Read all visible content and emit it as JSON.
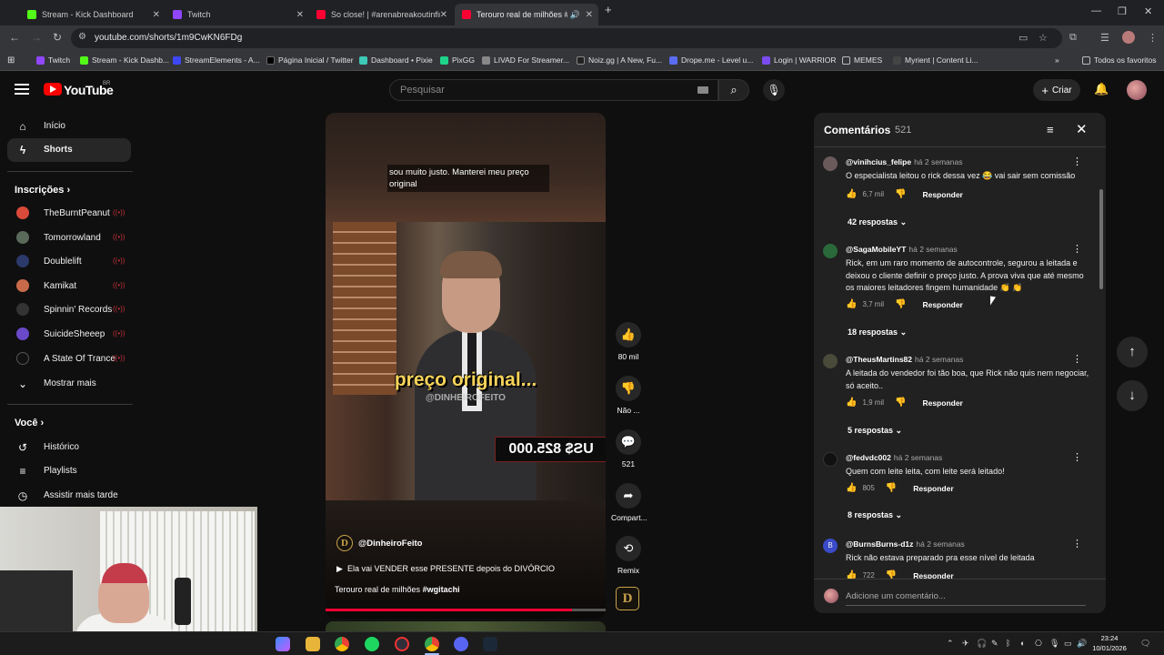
{
  "browser": {
    "tabs": [
      {
        "title": "Stream - Kick Dashboard",
        "color": "#53fc18",
        "active": false
      },
      {
        "title": "Twitch",
        "color": "#9146ff",
        "active": false
      },
      {
        "title": "So close! | #arenabreakoutinfin",
        "color": "#ff0033",
        "active": false
      },
      {
        "title": "Terouro real de milhões #w",
        "color": "#ff0033",
        "active": true
      }
    ],
    "url": "youtube.com/shorts/1m9CwKN6FDg",
    "bookmarks": [
      {
        "label": "Twitch",
        "color": "#9146ff"
      },
      {
        "label": "Stream - Kick Dashb...",
        "color": "#53fc18"
      },
      {
        "label": "StreamElements - A...",
        "color": "#3d47f2"
      },
      {
        "label": "Página Inicial / Twitter",
        "color": "#000000"
      },
      {
        "label": "Dashboard • Pixie",
        "color": "#3ec9b8"
      },
      {
        "label": "PixGG",
        "color": "#1ed48a"
      },
      {
        "label": "LIVAD For Streamer...",
        "color": "#888888"
      },
      {
        "label": "Noiz.gg | A New, Fu...",
        "color": "#222222"
      },
      {
        "label": "Drope.me - Level u...",
        "color": "#5a6cf0"
      },
      {
        "label": "Login | WARRIOR",
        "color": "#7a4cf0"
      },
      {
        "label": "MEMES",
        "color": "#bbbbbb"
      },
      {
        "label": "Myrient | Content Li...",
        "color": "#444444"
      }
    ],
    "all_bookmarks": "Todos os favoritos"
  },
  "header": {
    "logo": "YouTube",
    "country": "BR",
    "search_placeholder": "Pesquisar",
    "create_label": "Criar"
  },
  "sidebar": {
    "main": [
      {
        "label": "Início",
        "icon": "home-icon",
        "selected": false
      },
      {
        "label": "Shorts",
        "icon": "shorts-icon",
        "selected": true
      }
    ],
    "subs_title": "Inscrições",
    "subs": [
      {
        "label": "TheBurntPeanut",
        "color": "#d94a3a"
      },
      {
        "label": "Tomorrowland",
        "color": "#5a6a5a"
      },
      {
        "label": "Doublelift",
        "color": "#2b3a6a"
      },
      {
        "label": "Kamikat",
        "color": "#c86a4a"
      },
      {
        "label": "Spinnin' Records",
        "color": "#222222"
      },
      {
        "label": "SuicideSheeep",
        "color": "#6a4ac8"
      },
      {
        "label": "A State Of Trance",
        "color": "#111111"
      }
    ],
    "show_more": "Mostrar mais",
    "you_title": "Você",
    "you": [
      {
        "label": "Histórico",
        "icon": "history-icon"
      },
      {
        "label": "Playlists",
        "icon": "playlists-icon"
      },
      {
        "label": "Assistir mais tarde",
        "icon": "watch-later-icon"
      }
    ]
  },
  "video": {
    "caption": "sou muito justo. Manterei meu preço original",
    "overlay_text": "preço original...",
    "watermark": "@DINHEIROFEITO",
    "price_sign": "US$ 825.000",
    "channel": "@DinheiroFeito",
    "channel_initial": "D",
    "playlist": "Ela vai VENDER esse PRESENTE depois do DIVÓRCIO",
    "title": "Terouro real de milhões",
    "hashtag": "#wgitachi",
    "progress": 0.88
  },
  "actions": [
    {
      "label": "80 mil",
      "icon": "like-icon"
    },
    {
      "label": "Não ...",
      "icon": "dislike-icon"
    },
    {
      "label": "521",
      "icon": "comments-icon"
    },
    {
      "label": "Compart...",
      "icon": "share-icon"
    },
    {
      "label": "Remix",
      "icon": "remix-icon"
    }
  ],
  "comments": {
    "title": "Comentários",
    "count": "521",
    "add_placeholder": "Adicione um comentário...",
    "reply_label": "Responder",
    "items": [
      {
        "user": "@vinihcius_felipe",
        "time": "há 2 semanas",
        "text": "O especialista leitou o rick dessa vez 😂 vai sair sem comissão",
        "likes": "6,7 mil",
        "replies": "42 respostas",
        "avatar": "#6a5a5a"
      },
      {
        "user": "@SagaMobileYT",
        "time": "há 2 semanas",
        "text": "Rick, em um raro momento de autocontrole, segurou a leitada e deixou o cliente definir o preço justo. A prova viva que até mesmo os maiores leitadores fingem humanidade 👏 👏",
        "likes": "3,7 mil",
        "replies": "18 respostas",
        "avatar": "#2a6a3a"
      },
      {
        "user": "@TheusMartins82",
        "time": "há 2 semanas",
        "text": "A leitada do vendedor foi tão boa, que Rick não quis nem negociar, só aceito..",
        "likes": "1,9 mil",
        "replies": "5 respostas",
        "avatar": "#4a4a3a"
      },
      {
        "user": "@fedvdc002",
        "time": "há 2 semanas",
        "text": "Quem com leite leita, com leite será leitado!",
        "likes": "805",
        "replies": "8 respostas",
        "avatar": "#111111"
      },
      {
        "user": "@BurnsBurns-d1z",
        "time": "há 2 semanas",
        "text": "Rick não estava preparado pra esse nível de leitada",
        "likes": "722",
        "replies": "",
        "avatar": "#3a4ac8"
      }
    ]
  },
  "taskbar": {
    "time": "23:24",
    "date": "10/01/2026"
  }
}
